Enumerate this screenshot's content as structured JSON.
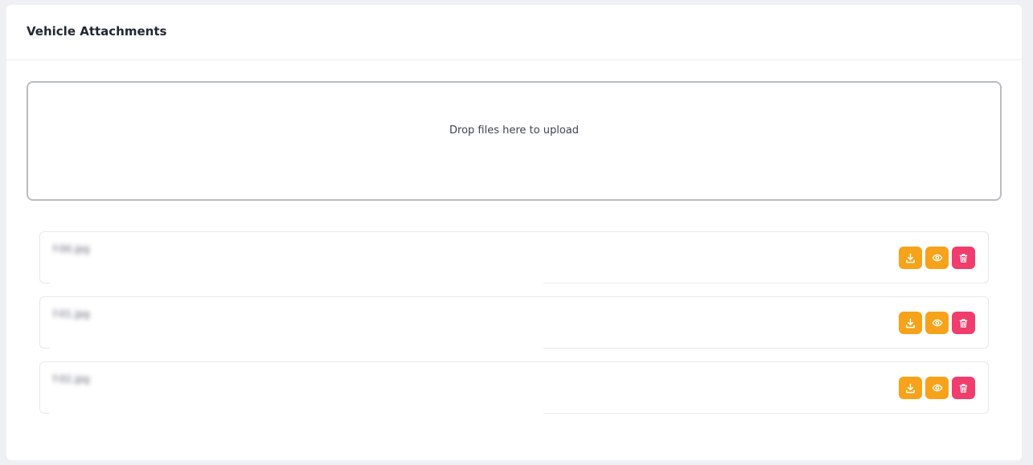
{
  "header": {
    "title": "Vehicle Attachments"
  },
  "dropzone": {
    "text": "Drop files here to upload"
  },
  "files": [
    {
      "name": "f-00.jpg",
      "size": ""
    },
    {
      "name": "f-01.jpg",
      "size": ""
    },
    {
      "name": "f-02.jpg",
      "size": ""
    }
  ],
  "colors": {
    "download_button": "#f7a21b",
    "view_button": "#f7a21b",
    "delete_button": "#f03d6e"
  },
  "icons": {
    "download": "download-icon",
    "view": "eye-icon",
    "delete": "trash-icon"
  }
}
